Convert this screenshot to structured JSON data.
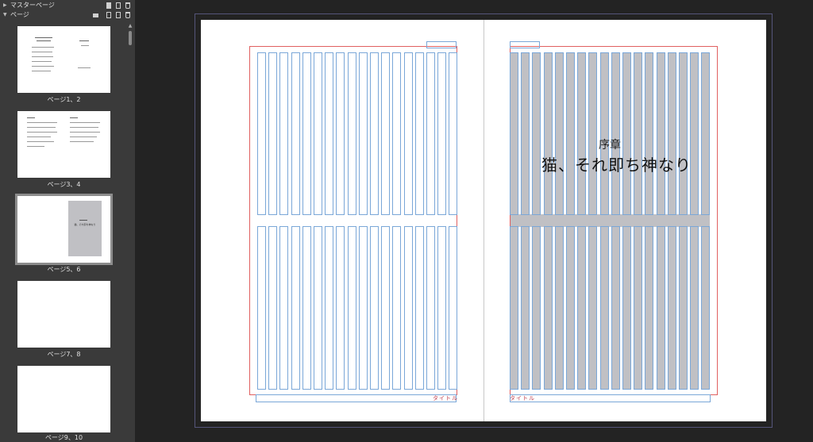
{
  "panel": {
    "master_pages_label": "マスターページ",
    "pages_label": "ページ",
    "pages": [
      {
        "label": "ページ1、2",
        "selected": false
      },
      {
        "label": "ページ3、4",
        "selected": false
      },
      {
        "label": "ページ5、6",
        "selected": true
      },
      {
        "label": "ページ7、8",
        "selected": false
      },
      {
        "label": "ページ9、10",
        "selected": false
      }
    ],
    "icons": [
      "master-page-icon",
      "new-page-icon",
      "delete-icon"
    ]
  },
  "spread": {
    "left_footer": "タイトル",
    "right_footer": "タイトル",
    "chapter_label": "序章",
    "chapter_title": "猫、それ即ち神なり",
    "mini_thumb_text": "猫、それ即ち神なり"
  },
  "colors": {
    "margin_guide": "#e06060",
    "frame_grid": "#7aa7d8",
    "selected_fill": "#c0c0c4",
    "panel_bg": "#3a3a3a",
    "workspace_bg": "#232323"
  }
}
